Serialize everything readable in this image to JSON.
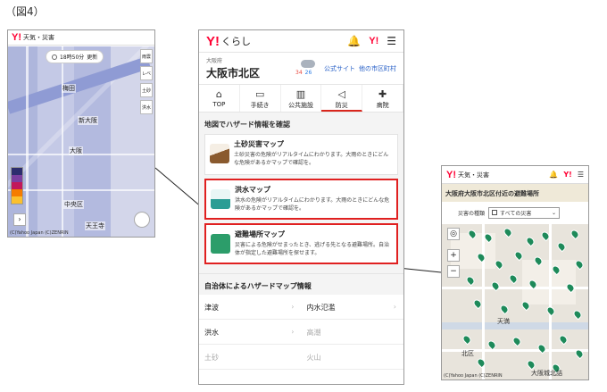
{
  "figure_label": "（図4）",
  "left_phone": {
    "brand": "Y!",
    "service": "天気・災害",
    "time": "18時50分",
    "time_suffix": "更新",
    "tools": [
      "雨雲",
      "レベル",
      "土砂",
      "洪水"
    ],
    "places": [
      "梅田",
      "新大阪",
      "大阪",
      "中央区",
      "天王寺"
    ],
    "legend_colors": [
      "#2d2d6e",
      "#7b3fa0",
      "#c2185b",
      "#f57c00",
      "#fbc02d"
    ],
    "copyright": "(C)Yahoo Japan (C)ZENRIN"
  },
  "center_phone": {
    "brand": "Y!",
    "service": "くらし",
    "brand_small": "Y!",
    "prefecture": "大阪府",
    "city": "大阪市北区",
    "temp_high": "34",
    "temp_low": "26",
    "link_official": "公式サイト",
    "link_other": "他の市区町村",
    "tabs": [
      {
        "label": "TOP",
        "icon": "home-icon"
      },
      {
        "label": "手続き",
        "icon": "document-icon"
      },
      {
        "label": "公共施設",
        "icon": "building-icon"
      },
      {
        "label": "防災",
        "icon": "megaphone-icon"
      },
      {
        "label": "病院",
        "icon": "hospital-icon"
      }
    ],
    "active_tab": "防災",
    "section_title": "地図でハザード情報を確認",
    "cards": [
      {
        "title": "土砂災害マップ",
        "desc": "土砂災害の危険がリアルタイムにわかります。大雨のときにどんな危険があるかマップで確認を。"
      },
      {
        "title": "洪水マップ",
        "desc": "洪水の危険がリアルタイムにわかります。大雨のときにどんな危険があるかマップで確認を。"
      },
      {
        "title": "避難場所マップ",
        "desc": "災害による危険がせまったとき、逃げる先となる避難場所。自治体が指定した避難場所を探せます。"
      }
    ],
    "muni_title": "自治体によるハザードマップ情報",
    "muni_items": [
      {
        "label": "津波"
      },
      {
        "label": "内水氾濫"
      },
      {
        "label": "洪水"
      },
      {
        "label": "高潮"
      },
      {
        "label": "土砂"
      },
      {
        "label": "火山"
      }
    ]
  },
  "right_phone": {
    "brand": "Y!",
    "service": "天気・災害",
    "brand_small": "Y!",
    "title": "大阪府大阪市北区付近の避難場所",
    "filter_label": "災害の種類",
    "filter_value": "すべての災害",
    "places": [
      "天満",
      "北区",
      "大阪城北詰"
    ],
    "copyright": "(C)Yahoo Japan (C)ZENRIN"
  },
  "colors": {
    "brand_red": "#ff0033",
    "highlight_red": "#e02020",
    "pin_green": "#1e8a5a"
  }
}
